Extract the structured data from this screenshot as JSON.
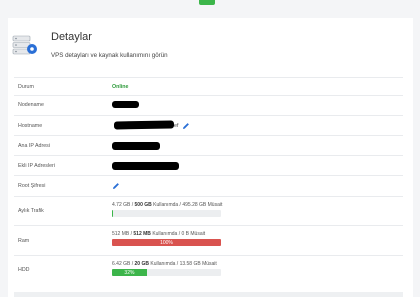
{
  "header": {
    "title": "Detaylar",
    "subtitle": "VPS detayları ve kaynak kullanımını görün",
    "icon": "server-gear-icon"
  },
  "details": [
    {
      "label": "Durum",
      "value": "Online"
    },
    {
      "label": "Nodename",
      "value": ""
    },
    {
      "label": "Hostname",
      "value_suffix": "ef",
      "edit_icon": "pencil-icon"
    },
    {
      "label": "Ana IP Adresi",
      "value": ""
    },
    {
      "label": "Ekli IP Adresleri",
      "value": ""
    },
    {
      "label": "Root Şifresi",
      "edit_icon": "pencil-icon"
    }
  ],
  "usage": {
    "traffic": {
      "label": "Aylık Trafik",
      "used": "4.72 GB",
      "total": "500 GB",
      "used_word": "Kullanımda",
      "free": "495.28 GB Müsait",
      "percent": 0.9,
      "bar_label": "",
      "color": "#3cb54a"
    },
    "ram": {
      "label": "Ram",
      "used": "512 MB",
      "total": "512 MB",
      "used_word": "Kullanımda",
      "free": "0 B Müsait",
      "percent": 100,
      "bar_label": "100%",
      "color": "#d9534f"
    },
    "hdd": {
      "label": "HDD",
      "used": "6.42 GB",
      "total": "20 GB",
      "used_word": "Kullanımda",
      "free": "13.58 GB Müsait",
      "percent": 32,
      "bar_label": "32%",
      "color": "#3cb54a"
    }
  },
  "colors": {
    "online": "#2e9b3b",
    "accent": "#2a6fd6",
    "danger": "#d9534f",
    "success": "#3cb54a"
  }
}
